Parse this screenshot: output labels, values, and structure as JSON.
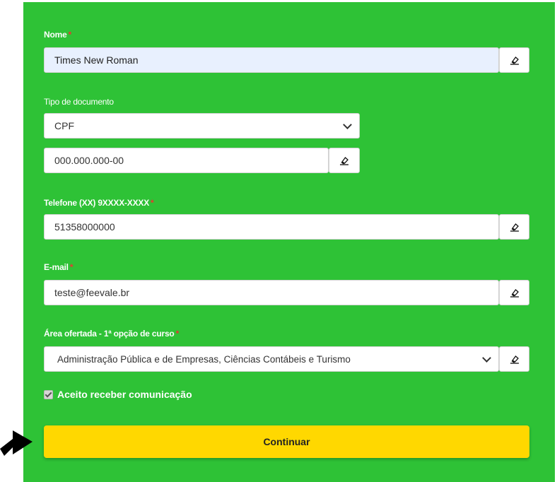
{
  "form": {
    "name": {
      "label": "Nome",
      "required": "*",
      "value": "Times New Roman"
    },
    "document": {
      "label": "Tipo de documento",
      "type_selected": "CPF",
      "placeholder": "000.000.000-00"
    },
    "phone": {
      "label": "Telefone (XX) 9XXXX-XXXX",
      "required": "*",
      "value": "51358000000"
    },
    "email": {
      "label": "E-mail",
      "required": "*",
      "value": "teste@feevale.br"
    },
    "course": {
      "label": "Área ofertada - 1ª opção de curso",
      "required": "*",
      "selected": "Administração Pública e de Empresas, Ciências Contábeis e Turismo"
    },
    "consent": {
      "label": "Aceito receber comunicação",
      "checked": true
    },
    "submit_label": "Continuar"
  },
  "icons": {
    "clear": "eraser-icon",
    "dropdown": "chevron-down-icon",
    "pointer": "arrow-right-icon"
  },
  "colors": {
    "panel_bg": "#2ec236",
    "button_bg": "#ffd800",
    "required": "#e8382f",
    "autofill_bg": "#e8f0fe"
  }
}
